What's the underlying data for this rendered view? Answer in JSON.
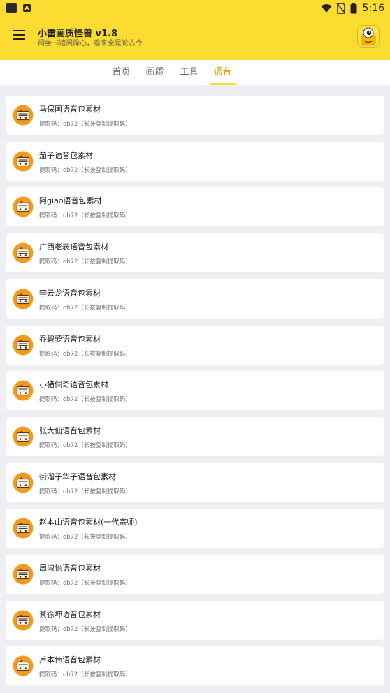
{
  "status_bar": {
    "time": "5:16"
  },
  "app_bar": {
    "title": "小雷画质怪兽 v1.8",
    "subtitle": "闷坐书馆闲操心，看来全是论古今"
  },
  "tabs": [
    {
      "label": "首页",
      "active": false
    },
    {
      "label": "画质",
      "active": false
    },
    {
      "label": "工具",
      "active": false
    },
    {
      "label": "语音",
      "active": true
    }
  ],
  "colors": {
    "accent": "#fddc31",
    "icon_orange": "#f39a1c",
    "background": "#efeff3"
  },
  "items": [
    {
      "title": "马保国语音包素材",
      "code": "提取码：ob72（长按复制提取码）",
      "icon": "radio-icon"
    },
    {
      "title": "茄子语音包素材",
      "code": "提取码：ob72（长按复制提取码）",
      "icon": "radio-icon"
    },
    {
      "title": "阿giao语音包素材",
      "code": "提取码：ob72（长按复制提取码）",
      "icon": "radio-icon"
    },
    {
      "title": "广西老表语音包素材",
      "code": "提取码：ob72（长按复制提取码）",
      "icon": "radio-icon"
    },
    {
      "title": "李云龙语音包素材",
      "code": "提取码：ob72（长按复制提取码）",
      "icon": "radio-icon"
    },
    {
      "title": "乔碧萝语音包素材",
      "code": "提取码：ob72（长按复制提取码）",
      "icon": "radio-icon"
    },
    {
      "title": "小猪佩奇语音包素材",
      "code": "提取码：ob72（长按复制提取码）",
      "icon": "radio-icon"
    },
    {
      "title": "张大仙语音包素材",
      "code": "提取码：ob72（长按复制提取码）",
      "icon": "radio-icon"
    },
    {
      "title": "街溜子华子语音包素材",
      "code": "提取码：ob72（长按复制提取码）",
      "icon": "radio-icon"
    },
    {
      "title": "赵本山语音包素材(一代宗师)",
      "code": "提取码：ob72（长按复制提取码）",
      "icon": "radio-icon"
    },
    {
      "title": "周淑怡语音包素材",
      "code": "提取码：ob72（长按复制提取码）",
      "icon": "radio-icon"
    },
    {
      "title": "蔡徐坤语音包素材",
      "code": "提取码：ob72（长按复制提取码）",
      "icon": "radio-icon"
    },
    {
      "title": "卢本伟语音包素材",
      "code": "提取码：ob72（长按复制提取码）",
      "icon": "radio-icon"
    }
  ]
}
